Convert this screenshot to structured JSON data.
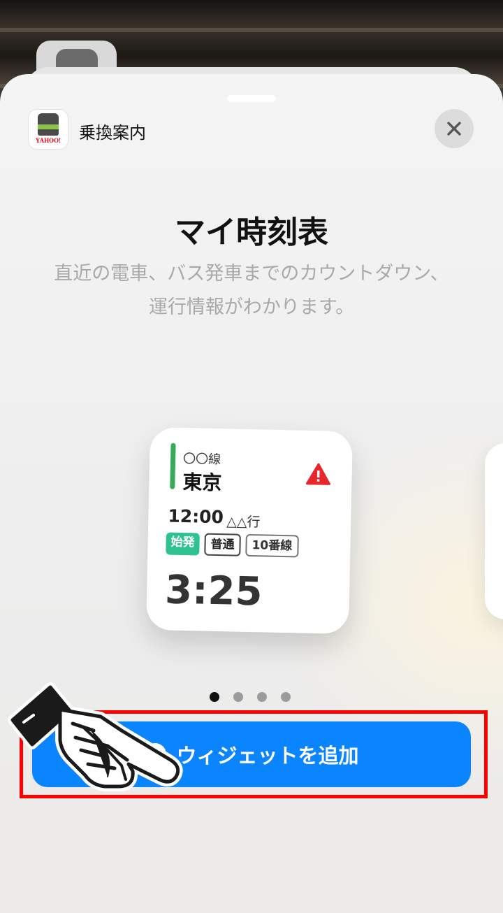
{
  "sheet": {
    "app_name": "乗換案内",
    "app_logo_text": "YAHOO!",
    "close_icon": "close-icon"
  },
  "content": {
    "title": "マイ時刻表",
    "description_line1": "直近の電車、バス発車までのカウントダウン、",
    "description_line2": "運行情報がわかります。"
  },
  "widget": {
    "line": "〇〇線",
    "station": "東京",
    "warning_icon": "warning-icon",
    "time": "12:00",
    "destination": "△△行",
    "badges": [
      "始発",
      "普通",
      "10番線"
    ],
    "countdown": "3:25",
    "colors": {
      "line_bar": "#39a95a",
      "first_train_badge": "#2fc18f",
      "warning": "#e8262d"
    }
  },
  "pagination": {
    "total": 4,
    "active": 0
  },
  "add_button": {
    "label": "ウィジェットを追加",
    "icon": "plus-circle-icon",
    "color": "#0a84ff"
  },
  "annotation": {
    "pointer_icon": "pointing-hand-icon",
    "highlight_color": "#ff0000"
  }
}
